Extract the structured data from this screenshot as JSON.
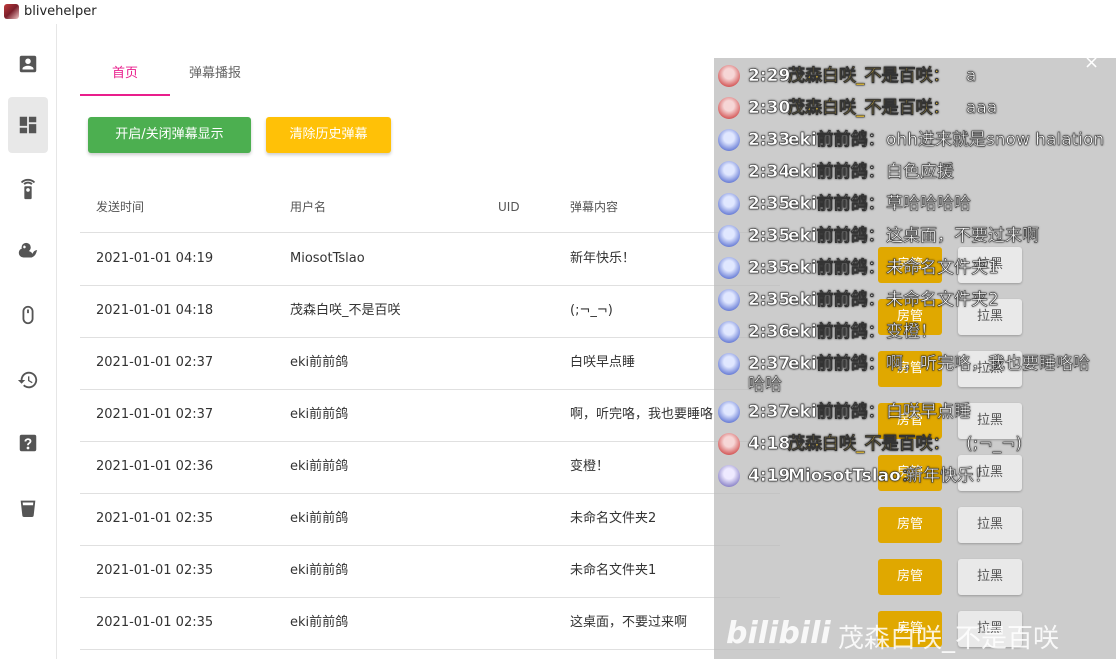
{
  "app": {
    "title": "blivehelper"
  },
  "sidebar": {
    "items": [
      {
        "icon": "account-box-icon"
      },
      {
        "icon": "dashboard-icon"
      },
      {
        "icon": "remote-icon"
      },
      {
        "icon": "duck-icon"
      },
      {
        "icon": "mouse-icon"
      },
      {
        "icon": "history-icon"
      },
      {
        "icon": "help-icon"
      },
      {
        "icon": "trash-icon"
      }
    ],
    "active_index": 1
  },
  "tabs": [
    {
      "label": "首页",
      "active": true
    },
    {
      "label": "弹幕播报",
      "active": false
    }
  ],
  "toolbar": {
    "toggle_label": "开启/关闭弹幕显示",
    "clear_label": "清除历史弹幕"
  },
  "table": {
    "headers": {
      "time": "发送时间",
      "user": "用户名",
      "uid": "UID",
      "message": "弹幕内容"
    },
    "rows": [
      {
        "time": "2021-01-01 04:19",
        "user": "MiosotTslao",
        "message": "新年快乐！"
      },
      {
        "time": "2021-01-01 04:18",
        "user": "茂森白咲_不是百咲",
        "message": "(;¬_¬)"
      },
      {
        "time": "2021-01-01 02:37",
        "user": "eki前前鸽",
        "message": "白咲早点睡"
      },
      {
        "time": "2021-01-01 02:37",
        "user": "eki前前鸽",
        "message": "啊，听完咯，我也要睡咯"
      },
      {
        "time": "2021-01-01 02:36",
        "user": "eki前前鸽",
        "message": "变橙！"
      },
      {
        "time": "2021-01-01 02:35",
        "user": "eki前前鸽",
        "message": "未命名文件夹2"
      },
      {
        "time": "2021-01-01 02:35",
        "user": "eki前前鸽",
        "message": "未命名文件夹1"
      },
      {
        "time": "2021-01-01 02:35",
        "user": "eki前前鸽",
        "message": "这桌面，不要过来啊"
      }
    ]
  },
  "actions": {
    "manager_label": "房管",
    "block_label": "拉黑"
  },
  "overlay": {
    "close": "×",
    "danmaku": [
      {
        "time": "2:29",
        "name": "茂森白咲_不是百咲",
        "text": "a",
        "avatar": "red",
        "name_color": "gold"
      },
      {
        "time": "2:30",
        "name": "茂森白咲_不是百咲",
        "text": "aaa",
        "avatar": "red",
        "name_color": "gold"
      },
      {
        "time": "2:33",
        "name": "eki前前鸽",
        "text": "ohh进来就是snow halation",
        "avatar": "blue",
        "name_color": "white"
      },
      {
        "time": "2:34",
        "name": "eki前前鸽",
        "text": "白色应援",
        "avatar": "blue",
        "name_color": "white"
      },
      {
        "time": "2:35",
        "name": "eki前前鸽",
        "text": "草哈哈哈哈",
        "avatar": "blue",
        "name_color": "white"
      },
      {
        "time": "2:35",
        "name": "eki前前鸽",
        "text": "这桌面，不要过来啊",
        "avatar": "blue",
        "name_color": "white"
      },
      {
        "time": "2:35",
        "name": "eki前前鸽",
        "text": "未命名文件夹1",
        "avatar": "blue",
        "name_color": "white"
      },
      {
        "time": "2:35",
        "name": "eki前前鸽",
        "text": "未命名文件夹2",
        "avatar": "blue",
        "name_color": "white"
      },
      {
        "time": "2:36",
        "name": "eki前前鸽",
        "text": "变橙！",
        "avatar": "blue",
        "name_color": "white"
      },
      {
        "time": "2:37",
        "name": "eki前前鸽",
        "text": "啊，听完咯，我也要睡咯哈",
        "avatar": "blue",
        "name_color": "white"
      },
      {
        "time": "2:37",
        "name": "eki前前鸽",
        "text": "白咲早点睡",
        "avatar": "blue",
        "name_color": "white"
      },
      {
        "time": "4:18",
        "name": "茂森白咲_不是百咲",
        "text": "(;¬_¬)",
        "avatar": "red",
        "name_color": "gold"
      },
      {
        "time": "4:19",
        "name": "MiosotTslao",
        "text": "新年快乐！",
        "avatar": "lavender",
        "name_color": "white"
      }
    ],
    "wrapped_tail": "哈哈",
    "watermark_logo": "bilibili",
    "watermark_text": "茂森白咲_不是百咲"
  },
  "colors": {
    "accent": "#e91e8c",
    "green": "#4caf50",
    "yellow": "#ffc107",
    "gold": "#ffd23c",
    "manager": "#e0a800"
  }
}
